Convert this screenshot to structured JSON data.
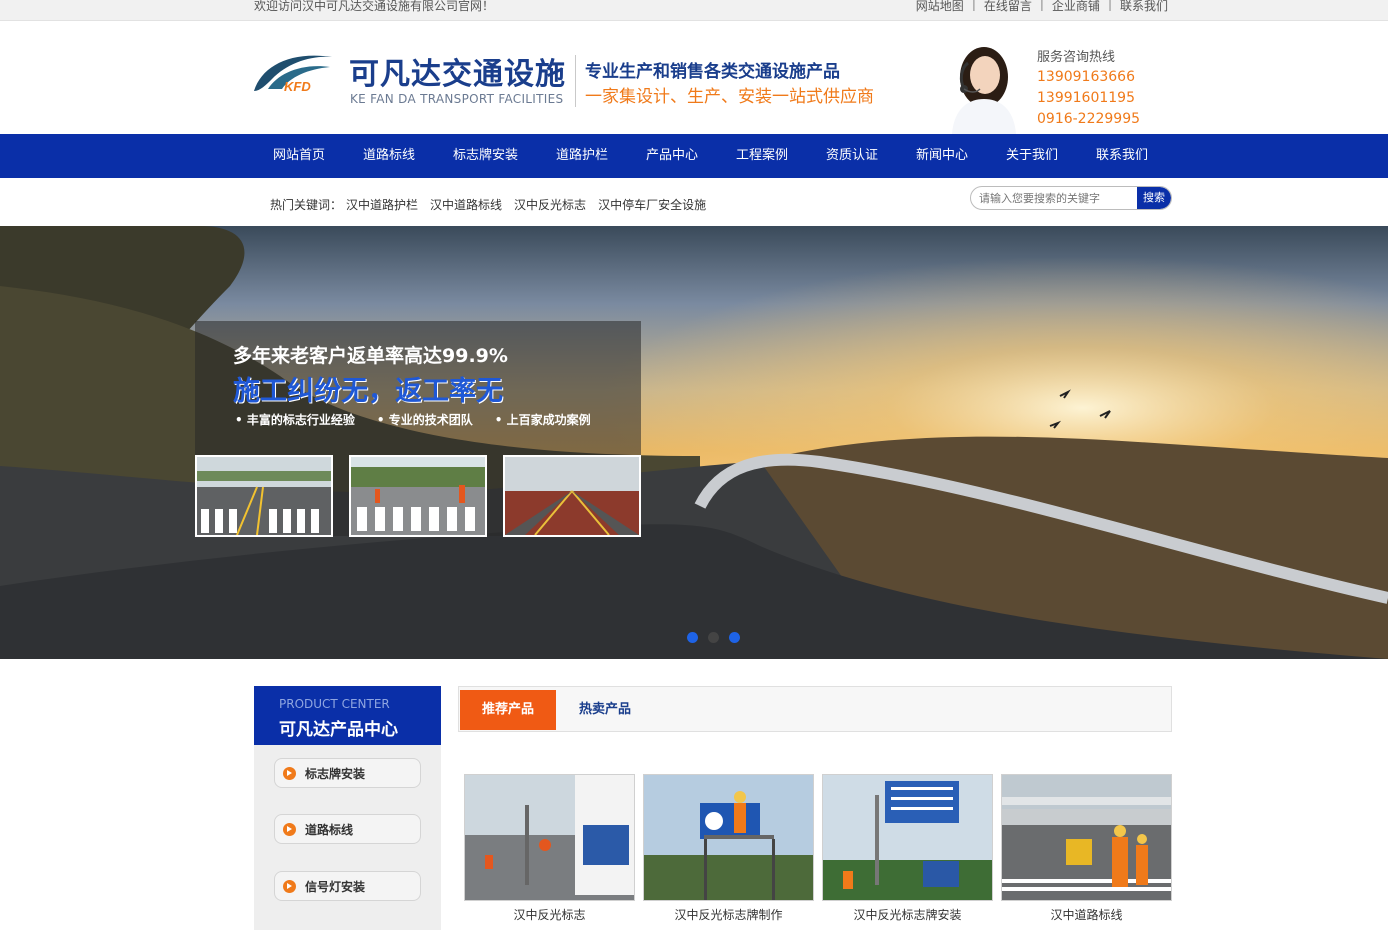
{
  "topbar": {
    "welcome": "欢迎访问汉中可凡达交通设施有限公司官网！",
    "links": [
      "网站地图",
      "在线留言",
      "企业商铺",
      "联系我们"
    ]
  },
  "header": {
    "logo_mark_text": "KFD",
    "logo_cn": "可凡达交通设施",
    "logo_en": "KE FAN DA TRANSPORT FACILITIES",
    "slogan_main": "专业生产和销售各类交通设施产品",
    "slogan_sub": "一家集设计、生产、安装一站式供应商",
    "hotline_title": "服务咨询热线",
    "hotline_numbers": [
      "13909163666",
      "13991601195",
      "0916-2229995"
    ]
  },
  "nav": {
    "items": [
      "网站首页",
      "道路标线",
      "标志牌安装",
      "道路护栏",
      "产品中心",
      "工程案例",
      "资质认证",
      "新闻中心",
      "关于我们",
      "联系我们"
    ]
  },
  "search": {
    "hot_label": "热门关键词：",
    "keywords": [
      "汉中道路护栏",
      "汉中道路标线",
      "汉中反光标志",
      "汉中停车厂安全设施"
    ],
    "placeholder": "请输入您要搜索的关键字",
    "button": "搜索"
  },
  "banner": {
    "line1": "多年来老客户返单率高达99.9%",
    "line2": "施工纠纷无，返工率无",
    "bullets": [
      "• 丰富的标志行业经验",
      "• 专业的技术团队",
      "• 上百家成功案例"
    ],
    "active_slide": 2,
    "slide_count": 3
  },
  "product_center": {
    "en": "PRODUCT CENTER",
    "cn": "可凡达产品中心",
    "items": [
      "标志牌安装",
      "道路标线",
      "信号灯安装"
    ]
  },
  "tabs": {
    "items": [
      "推荐产品",
      "热卖产品"
    ],
    "active": 0
  },
  "products": [
    "汉中反光标志",
    "汉中反光标志牌制作",
    "汉中反光标志牌安装",
    "汉中道路标线"
  ],
  "colors": {
    "brand_blue": "#0a2fa8",
    "accent_orange": "#f07a1a",
    "tab_orange": "#f05a14"
  }
}
